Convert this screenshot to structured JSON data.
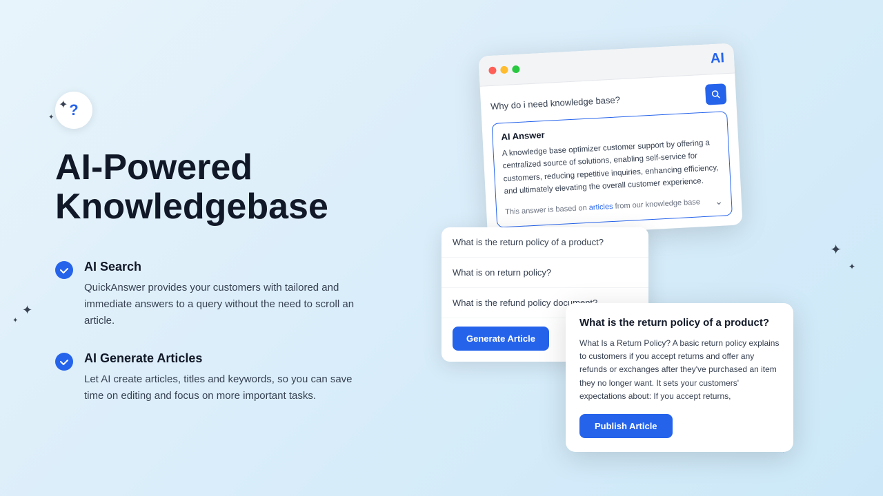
{
  "left": {
    "icon_label": "?",
    "title_line1": "AI-Powered",
    "title_line2": "Knowledgebase",
    "features": [
      {
        "id": "ai-search",
        "title": "AI Search",
        "description": "QuickAnswer provides your customers with tailored and immediate answers to a query without the need to scroll an article."
      },
      {
        "id": "ai-generate",
        "title": "AI Generate Articles",
        "description": "Let AI create articles, titles and keywords, so you can save time on editing and focus on more important tasks."
      }
    ]
  },
  "window": {
    "search_query": "Why do i need knowledge base?",
    "ai_label": "AI",
    "answer_title": "AI Answer",
    "answer_text": "A knowledge base optimizer customer support by offering a centralized source of solutions, enabling self-service for customers, reducing repetitive inquiries, enhancing efficiency, and ultimately elevating the overall customer experience.",
    "answer_footer": "This answer is based on",
    "answer_link": "articles",
    "answer_footer2": "from our knowledge base"
  },
  "suggestions": {
    "items": [
      "What is the return policy of a product?",
      "What is on return policy?",
      "What is the refund policy document?"
    ],
    "generate_btn": "Generate Article"
  },
  "article": {
    "title": "What is the return policy of a product?",
    "body": "What Is a Return Policy? A basic return policy explains to customers if you accept returns and offer any refunds or exchanges after they've purchased an item they no longer want. It sets your customers' expectations about: If you accept returns,",
    "publish_btn": "Publish Article"
  }
}
